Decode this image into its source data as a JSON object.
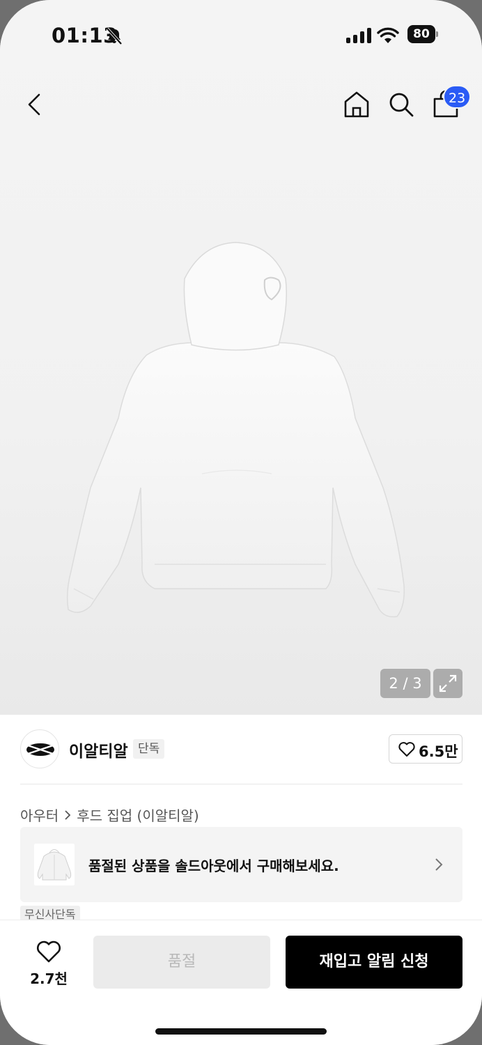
{
  "status_bar": {
    "time": "01:13",
    "battery": "80"
  },
  "nav": {
    "cart_count": "23"
  },
  "gallery": {
    "pager": "2 / 3"
  },
  "brand": {
    "name": "이알티알",
    "tag": "단독",
    "likes": "6.5만"
  },
  "breadcrumb": {
    "category": "아우터",
    "subcategory": "후드 집업 (이알티알)"
  },
  "soldout_banner": {
    "text": "품절된 상품을 솔드아웃에서 구매해보세요."
  },
  "exclusive_tag": "무신사단독",
  "bottom_bar": {
    "wish_count": "2.7천",
    "soldout_label": "품절",
    "restock_label": "재입고 알림 신청"
  },
  "colors": {
    "badge": "#2a5bf5",
    "primary_button": "#000000",
    "disabled_button": "#ebebeb"
  },
  "icons": [
    "bell-slash-icon",
    "signal-icon",
    "wifi-icon",
    "battery-icon",
    "back-icon",
    "home-icon",
    "search-icon",
    "cart-icon",
    "expand-icon",
    "heart-icon",
    "chevron-right-icon"
  ]
}
